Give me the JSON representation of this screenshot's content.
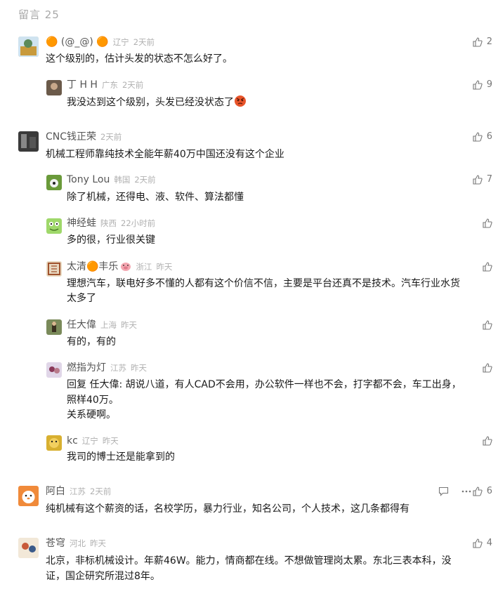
{
  "header": {
    "count_label": "留言 25"
  },
  "comments": [
    {
      "name": "🟠 (@_@) 🟠",
      "region": "辽宁",
      "time": "2天前",
      "text": "这个级别的，估计头发的状态不怎么好了。",
      "likes": "2"
    },
    {
      "name": "丁 H H",
      "region": "广东",
      "time": "2天前",
      "text": "我没达到这个级别，头发已经没状态了",
      "likes": "9"
    },
    {
      "name": "CNC钱正荣",
      "region": "",
      "time": "2天前",
      "text": "机械工程师靠纯技术全能年薪40万中国还没有这个企业",
      "likes": "6"
    },
    {
      "name": "Tony Lou",
      "region": "韩国",
      "time": "2天前",
      "text": "除了机械，还得电、液、软件、算法都懂",
      "likes": "7"
    },
    {
      "name": "神经蛙",
      "region": "陕西",
      "time": "22小时前",
      "text": "多的很，行业很关键",
      "likes": ""
    },
    {
      "name": "太清🟠丰乐",
      "region": "浙江",
      "time": "昨天",
      "text_lines": [
        "理想汽车，联电好多不懂的人都有这个价信不信，主要是平台还真不是技术。汽车行业水货",
        "太多了"
      ],
      "likes": ""
    },
    {
      "name": "任大偉",
      "region": "上海",
      "time": "昨天",
      "text": "有的，有的",
      "likes": ""
    },
    {
      "name": "燃指为灯",
      "region": "江苏",
      "time": "昨天",
      "text_lines": [
        "回复 任大偉: 胡说八道，有人CAD不会用，办公软件一样也不会，打字都不会，车工出身，",
        "照样40万。",
        "关系硬啊。"
      ],
      "likes": ""
    },
    {
      "name": "kc",
      "region": "辽宁",
      "time": "昨天",
      "text": "我司的博士还是能拿到的",
      "likes": ""
    },
    {
      "name": "阿白",
      "region": "江苏",
      "time": "2天前",
      "text": "纯机械有这个薪资的话，名校学历，暴力行业，知名公司，个人技术，这几条都得有",
      "likes": "6"
    },
    {
      "name": "苍穹",
      "region": "河北",
      "time": "昨天",
      "text_lines": [
        "北京，非标机械设计。年薪46W。能力，情商都在线。不想做管理岗太累。东北三表本科，没",
        "证，国企研究所混过8年。"
      ],
      "likes": "4"
    }
  ]
}
